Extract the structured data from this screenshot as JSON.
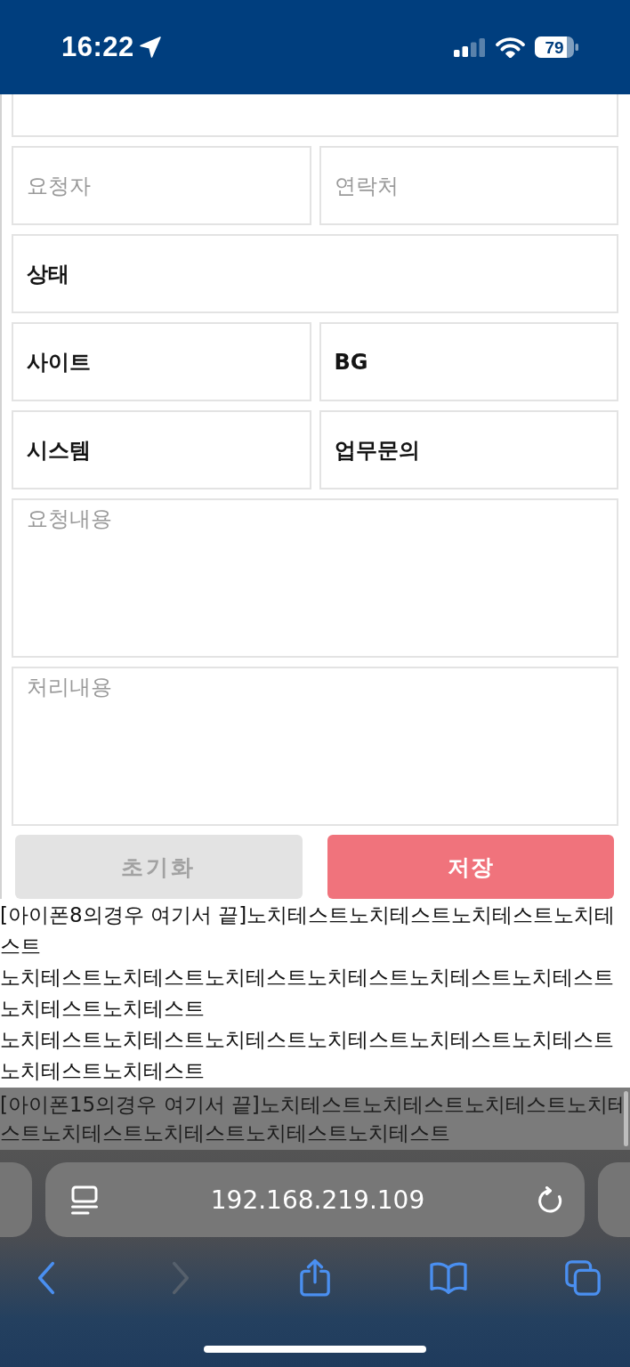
{
  "status_bar": {
    "time": "16:22",
    "battery": "79"
  },
  "form": {
    "rows": [
      [
        {
          "kind": "text"
        }
      ],
      [
        {
          "kind": "text",
          "placeholder": "요청자"
        },
        {
          "kind": "text",
          "placeholder": "연락처"
        }
      ],
      [
        {
          "kind": "select",
          "value": "상태"
        }
      ],
      [
        {
          "kind": "select",
          "value": "사이트"
        },
        {
          "kind": "select",
          "value": "BG"
        }
      ],
      [
        {
          "kind": "select",
          "value": "시스템"
        },
        {
          "kind": "select",
          "value": "업무문의"
        }
      ]
    ],
    "textareas": [
      {
        "placeholder": "요청내용"
      },
      {
        "placeholder": "처리내용"
      }
    ],
    "buttons": [
      {
        "label": "초기화",
        "kind": "reset"
      },
      {
        "label": "저장",
        "kind": "submit"
      }
    ]
  },
  "notes": [
    "[아이폰8의경우 여기서 끝]노치테스트노치테스트노치테스트노치테스트",
    "노치테스트노치테스트노치테스트노치테스트노치테스트노치테스트노치테스트노치테스트",
    "노치테스트노치테스트노치테스트노치테스트노치테스트노치테스트노치테스트노치테스트"
  ],
  "overlaid_note": "[아이폰15의경우 여기서 끝]노치테스트노치테스트노치테스트노치테스트노치테스트노치테스트노치테스트노치테스트",
  "browser": {
    "address": "192.168.219.109",
    "toolbar": [
      {
        "kind": "back",
        "disabled": false
      },
      {
        "kind": "forward",
        "disabled": true
      },
      {
        "kind": "share",
        "disabled": false
      },
      {
        "kind": "bookmarks",
        "disabled": false
      },
      {
        "kind": "tabs",
        "disabled": false
      }
    ]
  }
}
